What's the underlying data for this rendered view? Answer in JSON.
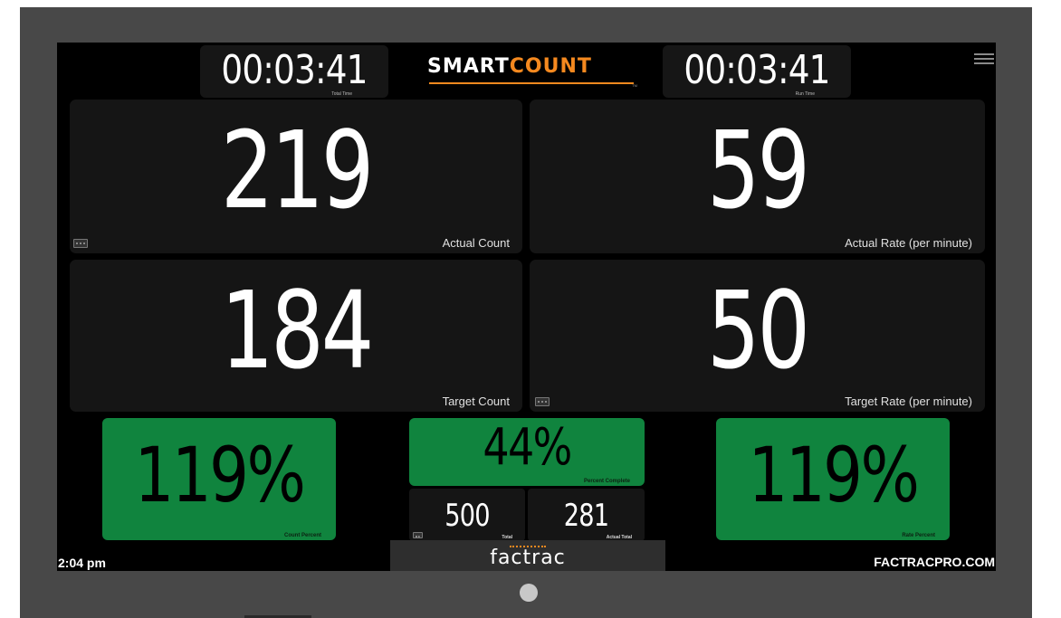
{
  "header": {
    "total_time": {
      "value": "00:03:41",
      "caption": "Total Time"
    },
    "run_time": {
      "value": "00:03:41",
      "caption": "Run Time"
    },
    "logo": {
      "smart": "SMART",
      "count": "COUNT",
      "tm": "TM"
    },
    "menu_icon": "hamburger-menu-icon"
  },
  "tiles": {
    "actual_count": {
      "value": "219",
      "label": "Actual Count"
    },
    "actual_rate": {
      "value": "59",
      "label": "Actual Rate (per minute)"
    },
    "target_count": {
      "value": "184",
      "label": "Target Count"
    },
    "target_rate": {
      "value": "50",
      "label": "Target Rate (per minute)"
    }
  },
  "percents": {
    "count_percent": {
      "value": "119%",
      "caption": "Count Percent"
    },
    "percent_complete": {
      "value": "44%",
      "caption": "Percent Complete"
    },
    "rate_percent": {
      "value": "119%",
      "caption": "Rate Percent"
    }
  },
  "totals": {
    "total": {
      "value": "500",
      "caption": "Total"
    },
    "actual_total": {
      "value": "281",
      "caption": "Actual Total"
    }
  },
  "footer": {
    "clock": "2:04 pm",
    "brand": "factrac",
    "url": "FACTRACPRO.COM"
  },
  "colors": {
    "accent": "#f5891f",
    "success_green": "#10843e",
    "tile_bg": "#151515",
    "screen_bg": "#000000",
    "bezel": "#484848"
  }
}
